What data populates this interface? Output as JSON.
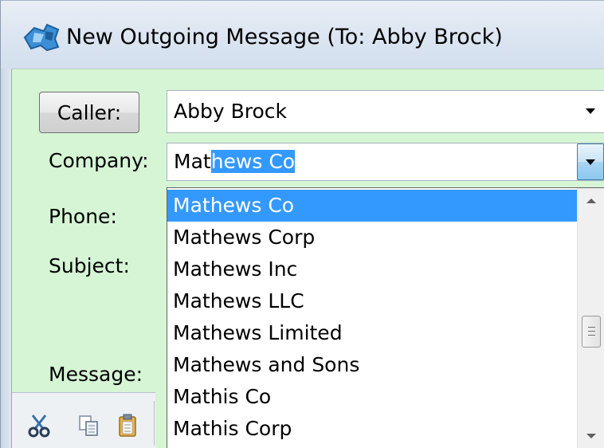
{
  "window": {
    "title": "New Outgoing Message (To: Abby Brock)",
    "app_icon": "app-logo-icon"
  },
  "form": {
    "caller_button_label": "Caller:",
    "caller_value": "Abby Brock",
    "company_label": "Company:",
    "company_typed": "Mat",
    "company_autocomplete": "hews Co",
    "phone_label": "Phone:",
    "subject_label": "Subject:",
    "message_label": "Message:"
  },
  "company_dropdown": {
    "items": [
      "Mathews Co",
      "Mathews Corp",
      "Mathews Inc",
      "Mathews LLC",
      "Mathews Limited",
      "Mathews and Sons",
      "Mathis Co",
      "Mathis Corp"
    ],
    "highlighted": "Mathews Co"
  },
  "toolbar": {
    "icons": [
      "cut-icon",
      "copy-icon",
      "paste-icon"
    ]
  },
  "colors": {
    "background": "#d5f5d5",
    "selection": "#3399ff",
    "titlebar": "#dbe5f1"
  }
}
